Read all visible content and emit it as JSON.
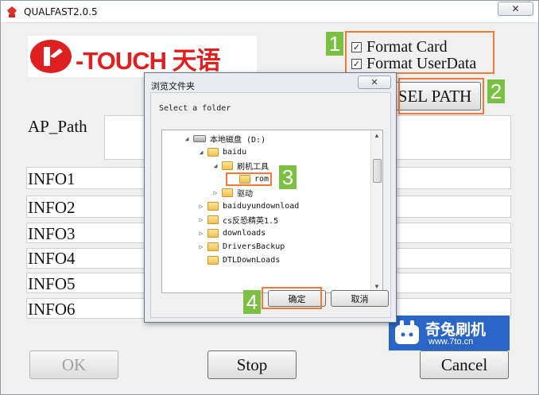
{
  "window": {
    "title": "QUALFAST2.0.5",
    "close_glyph": "✕"
  },
  "logo": {
    "text": "-TOUCH 天语"
  },
  "options": {
    "format_card": {
      "label": "Format Card",
      "checked": true
    },
    "format_userdata": {
      "label": "Format UserData",
      "checked": true
    }
  },
  "sel_path_button": "SEL PATH",
  "fields": {
    "ap_path": "AP_Path",
    "info": [
      "INFO1",
      "INFO2",
      "INFO3",
      "INFO4",
      "INFO5",
      "INFO6"
    ]
  },
  "buttons": {
    "ok": "OK",
    "stop": "Stop",
    "cancel": "Cancel"
  },
  "dialog": {
    "title": "浏览文件夹",
    "close_glyph": "✕",
    "prompt": "Select a folder",
    "tree": [
      {
        "label": "本地磁盘 (D:)",
        "expander": "◢",
        "icon": "drive-icon"
      },
      {
        "label": "baidu",
        "expander": "◢",
        "icon": "folder-icon"
      },
      {
        "label": "刷机工具",
        "expander": "◢",
        "icon": "folder-icon"
      },
      {
        "label": "rom",
        "expander": "",
        "icon": "folder-icon"
      },
      {
        "label": "驱动",
        "expander": "▷",
        "icon": "folder-icon"
      },
      {
        "label": "baiduyundownload",
        "expander": "▷",
        "icon": "folder-icon"
      },
      {
        "label": "cs反恐精英1.5",
        "expander": "▷",
        "icon": "folder-icon"
      },
      {
        "label": "downloads",
        "expander": "▷",
        "icon": "folder-icon"
      },
      {
        "label": "DriversBackup",
        "expander": "▷",
        "icon": "folder-icon"
      },
      {
        "label": "DTLDownLoads",
        "expander": "",
        "icon": "folder-icon"
      }
    ],
    "ok_button": "确定",
    "cancel_button": "取消"
  },
  "callouts": [
    "1",
    "2",
    "3",
    "4"
  ],
  "watermark": {
    "text": "奇兔刷机",
    "url": "www.7to.cn"
  },
  "colors": {
    "callout_border": "#f07a3a",
    "callout_badge": "#7bc043",
    "logo_red": "#e02020"
  }
}
